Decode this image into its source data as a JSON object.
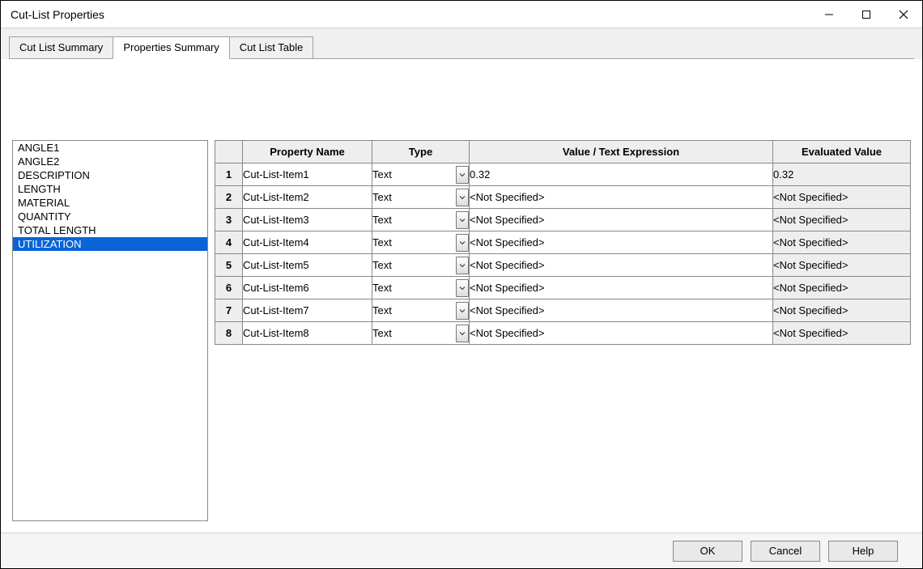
{
  "window": {
    "title": "Cut-List Properties"
  },
  "tabs": [
    {
      "label": "Cut List Summary",
      "active": false
    },
    {
      "label": "Properties Summary",
      "active": true
    },
    {
      "label": "Cut List Table",
      "active": false
    }
  ],
  "property_list": {
    "items": [
      "ANGLE1",
      "ANGLE2",
      "DESCRIPTION",
      "LENGTH",
      "MATERIAL",
      "QUANTITY",
      "TOTAL LENGTH",
      "UTILIZATION"
    ],
    "selected_index": 7
  },
  "grid": {
    "headers": {
      "property_name": "Property Name",
      "type": "Type",
      "value": "Value / Text Expression",
      "evaluated": "Evaluated Value"
    },
    "rows": [
      {
        "n": "1",
        "name": "Cut-List-Item1",
        "type": "Text",
        "value": "0.32",
        "evaluated": "0.32"
      },
      {
        "n": "2",
        "name": "Cut-List-Item2",
        "type": "Text",
        "value": "<Not Specified>",
        "evaluated": "<Not Specified>"
      },
      {
        "n": "3",
        "name": "Cut-List-Item3",
        "type": "Text",
        "value": "<Not Specified>",
        "evaluated": "<Not Specified>"
      },
      {
        "n": "4",
        "name": "Cut-List-Item4",
        "type": "Text",
        "value": "<Not Specified>",
        "evaluated": "<Not Specified>"
      },
      {
        "n": "5",
        "name": "Cut-List-Item5",
        "type": "Text",
        "value": "<Not Specified>",
        "evaluated": "<Not Specified>"
      },
      {
        "n": "6",
        "name": "Cut-List-Item6",
        "type": "Text",
        "value": "<Not Specified>",
        "evaluated": "<Not Specified>"
      },
      {
        "n": "7",
        "name": "Cut-List-Item7",
        "type": "Text",
        "value": "<Not Specified>",
        "evaluated": "<Not Specified>"
      },
      {
        "n": "8",
        "name": "Cut-List-Item8",
        "type": "Text",
        "value": "<Not Specified>",
        "evaluated": "<Not Specified>"
      }
    ]
  },
  "buttons": {
    "ok": "OK",
    "cancel": "Cancel",
    "help": "Help"
  }
}
